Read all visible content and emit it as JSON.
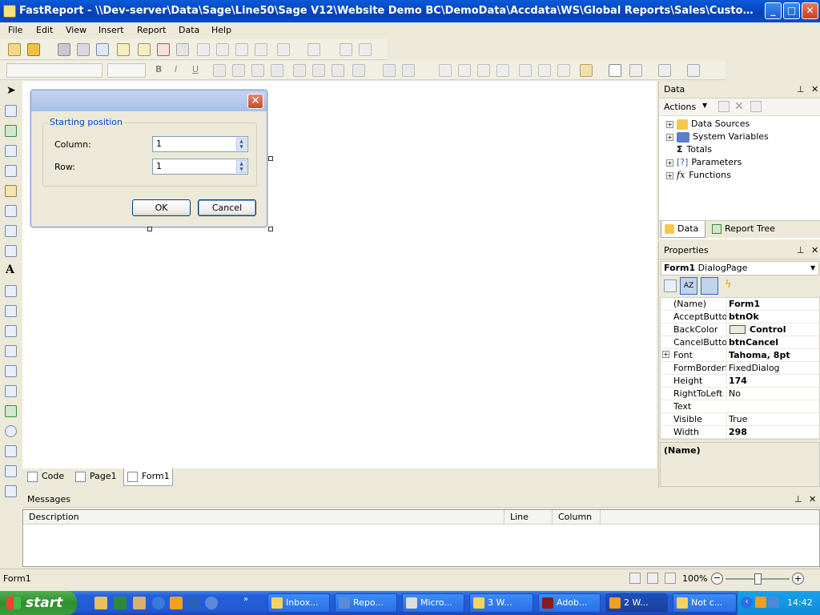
{
  "window": {
    "title": "FastReport - \\\\Dev-server\\Data\\Sage\\Line50\\Sage V12\\Website Demo BC\\DemoData\\Accdata\\WS\\Global Reports\\Sales\\Customers\\Contact Address Lab..."
  },
  "menu": {
    "items": [
      "File",
      "Edit",
      "View",
      "Insert",
      "Report",
      "Data",
      "Help"
    ]
  },
  "dialog": {
    "group_label": "Starting position",
    "column_label": "Column:",
    "column_value": "1",
    "row_label": "Row:",
    "row_value": "1",
    "ok_label": "OK",
    "cancel_label": "Cancel"
  },
  "page_tabs": [
    "Code",
    "Page1",
    "Form1"
  ],
  "data_panel": {
    "title": "Data",
    "actions_label": "Actions",
    "tree": [
      "Data Sources",
      "System Variables",
      "Totals",
      "Parameters",
      "Functions"
    ],
    "tabs": [
      "Data",
      "Report Tree"
    ]
  },
  "properties_panel": {
    "title": "Properties",
    "object_name": "Form1",
    "object_type": "DialogPage",
    "rows": [
      {
        "name": "(Name)",
        "value": "Form1"
      },
      {
        "name": "AcceptButton",
        "value": "btnOk"
      },
      {
        "name": "BackColor",
        "value": "Control"
      },
      {
        "name": "CancelButton",
        "value": "btnCancel"
      },
      {
        "name": "Font",
        "value": "Tahoma, 8pt"
      },
      {
        "name": "FormBorderStyle",
        "value": "FixedDialog"
      },
      {
        "name": "Height",
        "value": "174"
      },
      {
        "name": "RightToLeft",
        "value": "No"
      },
      {
        "name": "Text",
        "value": ""
      },
      {
        "name": "Visible",
        "value": "True"
      },
      {
        "name": "Width",
        "value": "298"
      }
    ],
    "description_title": "(Name)"
  },
  "messages": {
    "title": "Messages",
    "columns": [
      "Description",
      "Line",
      "Column"
    ]
  },
  "status": {
    "left": "Form1",
    "zoom": "100%",
    "zoom_level": 1.0
  },
  "taskbar": {
    "start_label": "start",
    "tasks": [
      "Inbox...",
      "Repo...",
      "Micro...",
      "3 W...",
      "Adob...",
      "2 W...",
      "Not c..."
    ],
    "clock": "14:42"
  }
}
